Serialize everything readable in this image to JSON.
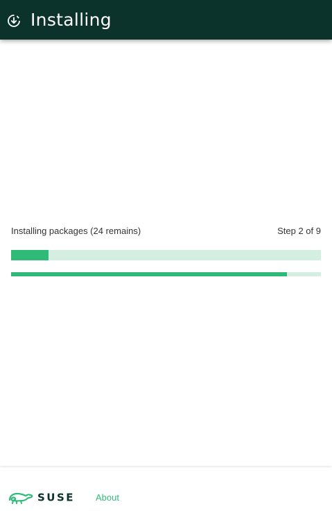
{
  "header": {
    "title": "Installing",
    "icon": "download-progress-icon"
  },
  "progress": {
    "label": "Installing packages (24 remains)",
    "step_label": "Step 2 of 9",
    "step_progress_fraction": 0.12,
    "overall_progress_fraction": 0.89
  },
  "footer": {
    "logo_text": "SUSE",
    "about_label": "About"
  },
  "colors": {
    "header_bg": "#0c322c",
    "accent": "#30ba78",
    "track": "#d4efe1"
  }
}
